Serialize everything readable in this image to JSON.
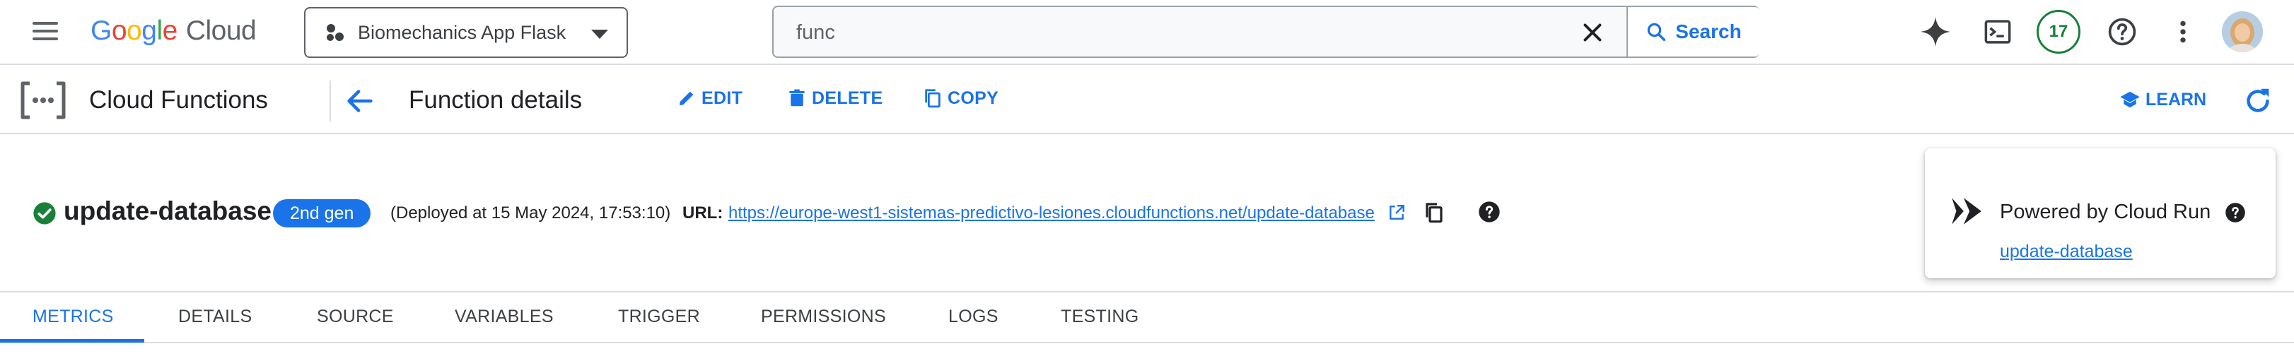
{
  "topbar": {
    "logo_text": "Google",
    "logo_suffix": "Cloud",
    "project_name": "Biomechanics App Flask",
    "search_value": "func",
    "search_button": "Search",
    "notification_count": "17",
    "icons": [
      "menu-icon",
      "project-icon",
      "chevron-down-icon",
      "close-icon",
      "search-icon",
      "gemini-sparkle-icon",
      "terminal-icon",
      "help-icon",
      "more-vert-icon",
      "avatar"
    ]
  },
  "subbar": {
    "product_name": "Cloud Functions",
    "page_title": "Function details",
    "edit": "EDIT",
    "delete": "DELETE",
    "copy": "COPY",
    "learn": "LEARN"
  },
  "function": {
    "name": "update-database",
    "generation": "2nd gen",
    "deployed": "(Deployed at 15 May 2024, 17:53:10)",
    "url_label": "URL:",
    "url": "https://europe-west1-sistemas-predictivo-lesiones.cloudfunctions.net/update-database",
    "status": "ok"
  },
  "cloud_run": {
    "title": "Powered by Cloud Run",
    "link": "update-database"
  },
  "tabs": [
    "METRICS",
    "DETAILS",
    "SOURCE",
    "VARIABLES",
    "TRIGGER",
    "PERMISSIONS",
    "LOGS",
    "TESTING"
  ],
  "active_tab": "METRICS",
  "colors": {
    "accent": "#1a73e8",
    "success": "#188038",
    "text": "#202124",
    "border": "#dadce0"
  }
}
